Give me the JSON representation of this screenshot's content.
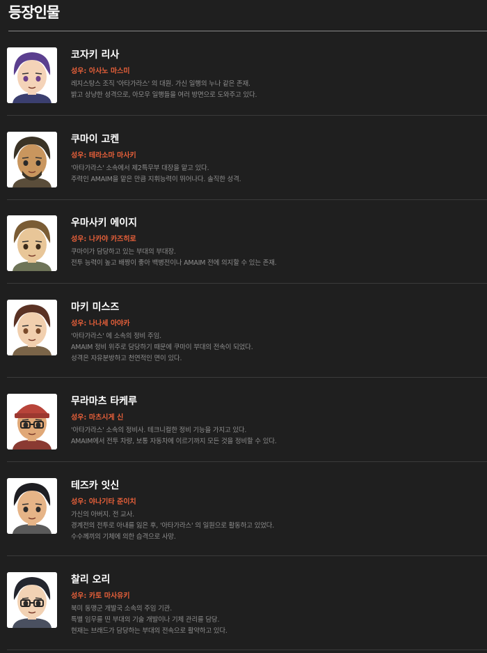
{
  "page": {
    "title": "등장인물"
  },
  "characters": [
    {
      "name": "코자키 리사",
      "voice": "성우: 아사노 마스미",
      "desc": [
        "레지스탕스 조직 '아타가라스' 의 대원. 가신 일행의 누나 같은 존재.",
        "밝고 상냥한 성격으로, 아모우 일행들을 여러 방면으로 도와주고 있다."
      ],
      "colors": {
        "hair": "#5b3f8f",
        "skin": "#f4d3b8",
        "eye": "#6b3f8a",
        "cloth": "#3b3f6f"
      }
    },
    {
      "name": "쿠마이 고켄",
      "voice": "성우: 테라소마 마사키",
      "desc": [
        "'아타가라스' 소속에서 제2특무부 대장을 맡고 있다.",
        "주력인 AMAIM을 맡은 만큼 지휘능력이 뛰어나다. 솔직한 성격."
      ],
      "colors": {
        "hair": "#3a3326",
        "skin": "#c9965e",
        "eye": "#2a2a2a",
        "cloth": "#5a4d3a"
      }
    },
    {
      "name": "우마사키 에이지",
      "voice": "성우: 나카야 카즈히로",
      "desc": [
        "쿠마이가 담당하고 있는 부대의 부대장.",
        "전투 능력이 높고 배짱이 좋아 백병전이나 AMAIM 전에 의지할 수 있는 존재."
      ],
      "colors": {
        "hair": "#7a5c34",
        "skin": "#e8c698",
        "eye": "#3a2a1a",
        "cloth": "#6e7458"
      }
    },
    {
      "name": "마키 미스즈",
      "voice": "성우: 나나세 아야카",
      "desc": [
        "'아타가라스' 에 소속의 정비 주임.",
        "AMAIM 정비 위주로 담당하기 때문에 쿠마이 부대의 전속이 되었다.",
        "성격은 자유분방하고 천연적인 면이 있다."
      ],
      "colors": {
        "hair": "#5a3224",
        "skin": "#f1cfae",
        "eye": "#7a4a2a",
        "cloth": "#7a6448"
      }
    },
    {
      "name": "무라마츠 타케루",
      "voice": "성우: 마츠시게 신",
      "desc": [
        "'아타가라스' 소속의 정비사. 테크니컬한 정비 기능을 가지고 있다.",
        "AMAIM에서 전투 차량, 보통 자동차에 이르기까지 모든 것을 정비할 수 있다."
      ],
      "colors": {
        "hair": "#b8443a",
        "skin": "#e0a877",
        "eye": "#2a2a2a",
        "cloth": "#8a3a32"
      }
    },
    {
      "name": "테즈카 잇신",
      "voice": "성우: 야나기타 준이치",
      "desc": [
        "가신의 아버지. 전 교사.",
        "경계전의 전투로 아내를 잃은 후, '아타가라스' 의 일원으로 활동하고 있었다.",
        "수수께끼의 기체에 의한 습격으로 사망."
      ],
      "colors": {
        "hair": "#1e1e22",
        "skin": "#e6b487",
        "eye": "#2a2a2a",
        "cloth": "#5a5a5a"
      }
    },
    {
      "name": "찰리 오리",
      "voice": "성우: 카토 마사유키",
      "desc": [
        "북미 동맹군 개발국 소속의 주임 기관.",
        "특별 임무를 띤 부대의 기술 개발이나 기체 관리를 담당.",
        "현재는 브래드가 담당하는 부대의 전속으로 활약하고 있다."
      ],
      "colors": {
        "hair": "#24262e",
        "skin": "#f2d2b4",
        "eye": "#2a2a2a",
        "cloth": "#4a5060"
      }
    }
  ]
}
